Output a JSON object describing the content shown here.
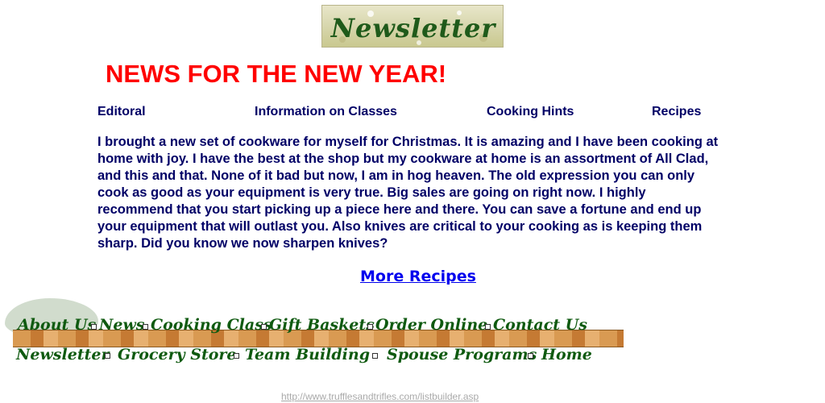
{
  "logo": {
    "text": "Newsletter"
  },
  "headline": "NEWS FOR THE NEW YEAR!",
  "top_nav": [
    {
      "label": "Editoral"
    },
    {
      "label": "Information on Classes"
    },
    {
      "label": "Cooking Hints"
    },
    {
      "label": "Recipes"
    }
  ],
  "body": {
    "paragraph": "I brought a new set of cookware for myself for Christmas. It is amazing and I have been cooking at home with joy.  I have the best at the shop but my cookware at home is an assortment of All Clad, and this and that.  None of it bad but now, I am in hog heaven. The old expression you can only cook as good as your equipment is very true. Big sales are going on right now. I highly recommend that you start picking up a piece here and there. You can save a fortune and end up your equipment that will outlast you. Also knives are critical to your cooking as is keeping them sharp.  Did you know we now sharpen knives?"
  },
  "more_link": "More Recipes",
  "bottom_nav": {
    "row1": [
      "About Us",
      "News",
      "Cooking Class",
      "Gift Baskets",
      "Order Online",
      "Contact Us"
    ],
    "row2": [
      "Newsletter",
      "Grocery Store",
      "Team Building",
      "Spouse Programs",
      "Home"
    ]
  },
  "footer_url": "http://www.trufflesandtrifles.com/listbuilder.asp",
  "colors": {
    "headline": "#ff0000",
    "body_text": "#000066",
    "link": "#0000ee",
    "nav_script": "#0f5a10"
  }
}
